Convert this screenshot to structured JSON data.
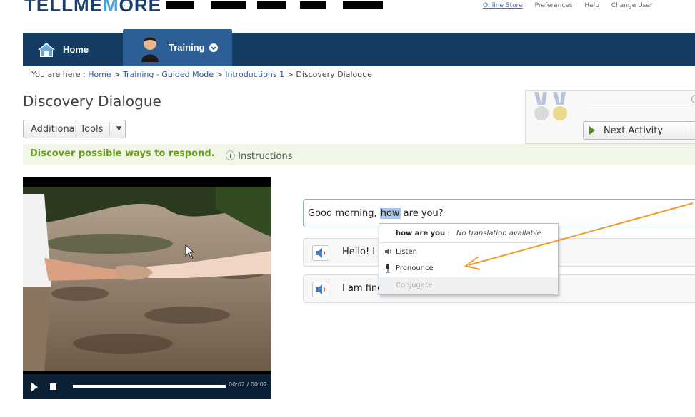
{
  "header": {
    "logo_part1": "TELLME",
    "logo_o": "M",
    "logo_part2": "ORE",
    "top_links": [
      "Online Store",
      "Preferences",
      "Help",
      "Change User"
    ]
  },
  "nav": {
    "home_label": "Home",
    "training_label": "Training"
  },
  "breadcrumb": {
    "prefix": "You are here : ",
    "items": [
      "Home",
      "Training - Guided Mode",
      "Introductions 1"
    ],
    "current": "Discovery Dialogue",
    "sep": " > "
  },
  "page": {
    "title": "Discovery Dialogue",
    "tools_label": "Additional Tools",
    "next_label": "Next Activity",
    "instruction": "Discover possible ways to respond.",
    "instructions_link": "Instructions"
  },
  "video": {
    "time": "00:02 / 00:02",
    "progress": 1.0
  },
  "dialogue": {
    "input_before": "Good morning, ",
    "input_highlight": "how",
    "input_after": " are you?",
    "responses": [
      "Hello! I a",
      "I am fine"
    ]
  },
  "context_menu": {
    "word": "how are you",
    "translation_sep": " : ",
    "translation": "No translation available",
    "items": [
      "Listen",
      "Pronounce",
      "Conjugate"
    ]
  },
  "colors": {
    "nav": "#153c63",
    "nav_active": "#2c5f95",
    "instruction_green": "#6c9a22",
    "annotation_arrow": "#f39a2b"
  }
}
